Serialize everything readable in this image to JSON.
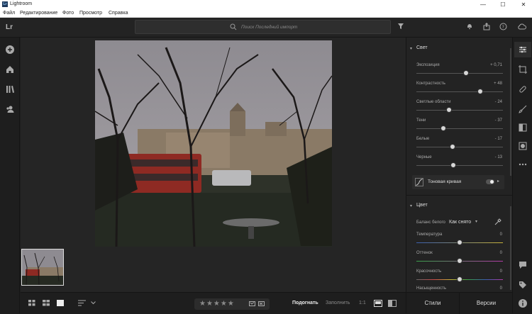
{
  "window": {
    "title": "Lightroom",
    "logo": "Lr",
    "minimize": "—",
    "maximize": "☐",
    "close": "✕"
  },
  "menu": [
    "Файл",
    "Редактирование",
    "Фото",
    "Просмотр",
    "Справка"
  ],
  "topbar": {
    "brand": "Lr",
    "search_placeholder": "Поиск Последний импорт"
  },
  "panel": {
    "light": {
      "title": "Свет",
      "sliders": [
        {
          "label": "Экспозиция",
          "value": "+ 0,71",
          "level": 0.57
        },
        {
          "label": "Контрастность",
          "value": "+ 48",
          "level": 0.74
        },
        {
          "label": "Светлые области",
          "value": "- 24",
          "level": 0.38
        },
        {
          "label": "Тени",
          "value": "- 37",
          "level": 0.31
        },
        {
          "label": "Белые",
          "value": "- 17",
          "level": 0.42
        },
        {
          "label": "Черные",
          "value": "- 13",
          "level": 0.43
        }
      ],
      "tone_curve": "Тоновая кривая"
    },
    "color": {
      "title": "Цвет",
      "wb_label": "Баланс белого",
      "wb_value": "Как снято",
      "sliders": [
        {
          "label": "Температура",
          "value": "0",
          "level": 0.5
        },
        {
          "label": "Оттенок",
          "value": "0",
          "level": 0.5
        },
        {
          "label": "Красочность",
          "value": "0",
          "level": 0.5
        },
        {
          "label": "Насыщенность",
          "value": "0",
          "level": 0.5
        }
      ]
    }
  },
  "bottombar": {
    "fit": "Подогнать",
    "fill": "Заполнить",
    "ratio": "1:1"
  },
  "buttons": {
    "presets": "Стили",
    "versions": "Версии"
  },
  "colors": {
    "accent": "#2a8ae2",
    "panel_bg": "#232323",
    "app_bg": "#1e1e1e"
  }
}
